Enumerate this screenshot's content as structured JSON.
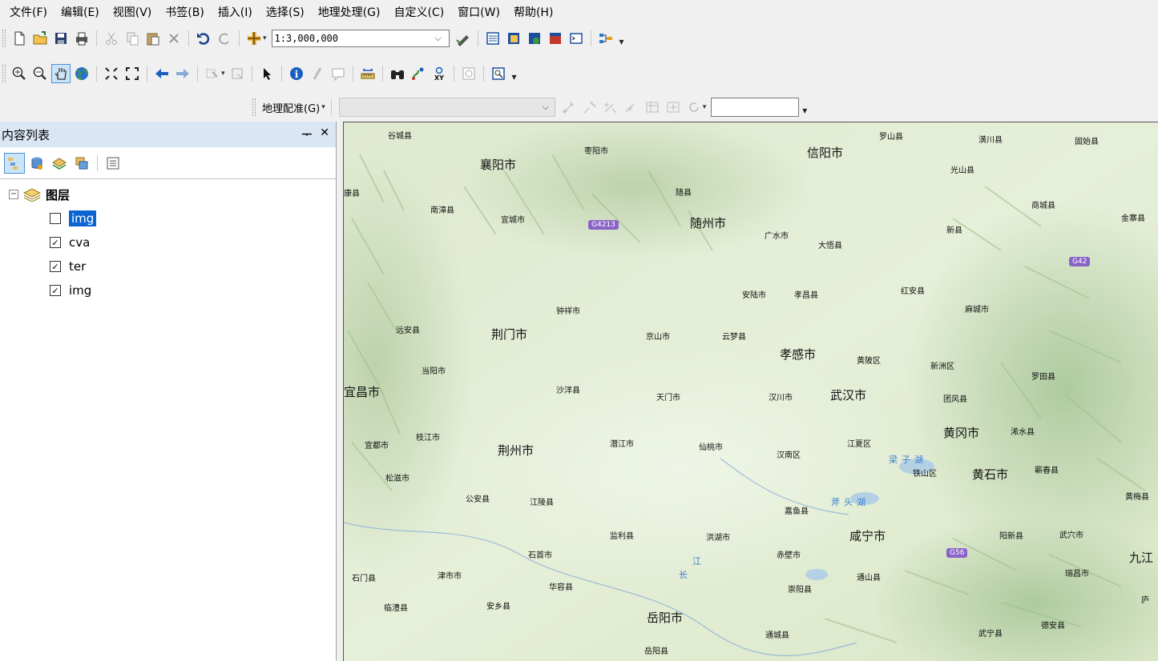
{
  "menu": [
    "文件(F)",
    "编辑(E)",
    "视图(V)",
    "书签(B)",
    "插入(I)",
    "选择(S)",
    "地理处理(G)",
    "自定义(C)",
    "窗口(W)",
    "帮助(H)"
  ],
  "standard_toolbar": {
    "scale_value": "1:3,000,000",
    "icons": [
      "new-document-icon",
      "open-folder-icon",
      "save-icon",
      "print-icon",
      "cut-icon",
      "copy-icon",
      "paste-icon",
      "delete-icon",
      "undo-icon",
      "redo-icon",
      "add-data-icon",
      "editor-toolbar-icon",
      "toc-window-icon",
      "catalog-icon",
      "search-window-icon",
      "arctoolbox-icon",
      "python-icon",
      "modelbuilder-icon"
    ]
  },
  "tools_toolbar": {
    "icons": [
      "zoom-in-icon",
      "zoom-out-icon",
      "pan-hand-icon",
      "full-extent-globe-icon",
      "fixed-zoom-in-icon",
      "fixed-zoom-out-icon",
      "back-arrow-icon",
      "forward-arrow-icon",
      "select-features-icon",
      "clear-selection-icon",
      "select-pointer-icon",
      "identify-icon",
      "hyperlink-icon",
      "html-popup-icon",
      "measure-icon",
      "find-binoculars-icon",
      "find-route-icon",
      "goto-xy-icon",
      "time-slider-icon",
      "viewer-window-icon"
    ]
  },
  "georef_toolbar": {
    "label": "地理配准(G)",
    "icons": [
      "add-control-points-icon",
      "auto-register-icon",
      "link-table-icon",
      "rotate-icon",
      "view-link-table-icon",
      "rectify-icon"
    ]
  },
  "toc": {
    "title": "内容列表",
    "pin_glyph": "ᅮ",
    "close_glyph": "✕",
    "group_label": "图层",
    "layers": [
      {
        "name": "img",
        "checked": false,
        "selected": true
      },
      {
        "name": "cva",
        "checked": true,
        "selected": false
      },
      {
        "name": "ter",
        "checked": true,
        "selected": false
      },
      {
        "name": "img",
        "checked": true,
        "selected": false
      }
    ]
  },
  "map": {
    "places": [
      {
        "name": "谷城县",
        "big": false
      },
      {
        "name": "枣阳市",
        "big": false
      },
      {
        "name": "襄阳市",
        "big": true
      },
      {
        "name": "信阳市",
        "big": true
      },
      {
        "name": "罗山县",
        "big": false
      },
      {
        "name": "潢川县",
        "big": false
      },
      {
        "name": "固始县",
        "big": false
      },
      {
        "name": "光山县",
        "big": false
      },
      {
        "name": "康县",
        "big": false
      },
      {
        "name": "随县",
        "big": false
      },
      {
        "name": "南漳县",
        "big": false
      },
      {
        "name": "宜城市",
        "big": false
      },
      {
        "name": "随州市",
        "big": true
      },
      {
        "name": "商城县",
        "big": false
      },
      {
        "name": "金寨县",
        "big": false
      },
      {
        "name": "广水市",
        "big": false
      },
      {
        "name": "新县",
        "big": false
      },
      {
        "name": "大悟县",
        "big": false
      },
      {
        "name": "红安县",
        "big": false
      },
      {
        "name": "安陆市",
        "big": false
      },
      {
        "name": "孝昌县",
        "big": false
      },
      {
        "name": "麻城市",
        "big": false
      },
      {
        "name": "钟祥市",
        "big": false
      },
      {
        "name": "远安县",
        "big": false
      },
      {
        "name": "荆门市",
        "big": true
      },
      {
        "name": "京山市",
        "big": false
      },
      {
        "name": "云梦县",
        "big": false
      },
      {
        "name": "孝感市",
        "big": true
      },
      {
        "name": "黄陂区",
        "big": false
      },
      {
        "name": "新洲区",
        "big": false
      },
      {
        "name": "当阳市",
        "big": false
      },
      {
        "name": "罗田县",
        "big": false
      },
      {
        "name": "宜昌市",
        "big": true
      },
      {
        "name": "沙洋县",
        "big": false
      },
      {
        "name": "天门市",
        "big": false
      },
      {
        "name": "汉川市",
        "big": false
      },
      {
        "name": "武汉市",
        "big": true
      },
      {
        "name": "团风县",
        "big": false
      },
      {
        "name": "宜都市",
        "big": false
      },
      {
        "name": "枝江市",
        "big": false
      },
      {
        "name": "荆州市",
        "big": true
      },
      {
        "name": "潜江市",
        "big": false
      },
      {
        "name": "仙桃市",
        "big": false
      },
      {
        "name": "江夏区",
        "big": false
      },
      {
        "name": "黄冈市",
        "big": true
      },
      {
        "name": "浠水县",
        "big": false
      },
      {
        "name": "汉南区",
        "big": false
      },
      {
        "name": "松滋市",
        "big": false
      },
      {
        "name": "铁山区",
        "big": false
      },
      {
        "name": "黄石市",
        "big": true
      },
      {
        "name": "蕲春县",
        "big": false
      },
      {
        "name": "公安县",
        "big": false
      },
      {
        "name": "江陵县",
        "big": false
      },
      {
        "name": "嘉鱼县",
        "big": false
      },
      {
        "name": "黄梅县",
        "big": false
      },
      {
        "name": "监利县",
        "big": false
      },
      {
        "name": "洪湖市",
        "big": false
      },
      {
        "name": "咸宁市",
        "big": true
      },
      {
        "name": "阳新县",
        "big": false
      },
      {
        "name": "武穴市",
        "big": false
      },
      {
        "name": "石首市",
        "big": false
      },
      {
        "name": "赤壁市",
        "big": false
      },
      {
        "name": "九江",
        "big": true
      },
      {
        "name": "石门县",
        "big": false
      },
      {
        "name": "津市市",
        "big": false
      },
      {
        "name": "华容县",
        "big": false
      },
      {
        "name": "通山县",
        "big": false
      },
      {
        "name": "瑞昌市",
        "big": false
      },
      {
        "name": "崇阳县",
        "big": false
      },
      {
        "name": "庐",
        "big": false
      },
      {
        "name": "临澧县",
        "big": false
      },
      {
        "name": "安乡县",
        "big": false
      },
      {
        "name": "岳阳市",
        "big": true
      },
      {
        "name": "德安县",
        "big": false
      },
      {
        "name": "通城县",
        "big": false
      },
      {
        "name": "武宁县",
        "big": false
      },
      {
        "name": "岳阳县",
        "big": false
      }
    ],
    "water": [
      "梁子湖",
      "斧头湖",
      "江",
      "长"
    ],
    "shields": [
      "G4213",
      "G42",
      "G56"
    ]
  }
}
